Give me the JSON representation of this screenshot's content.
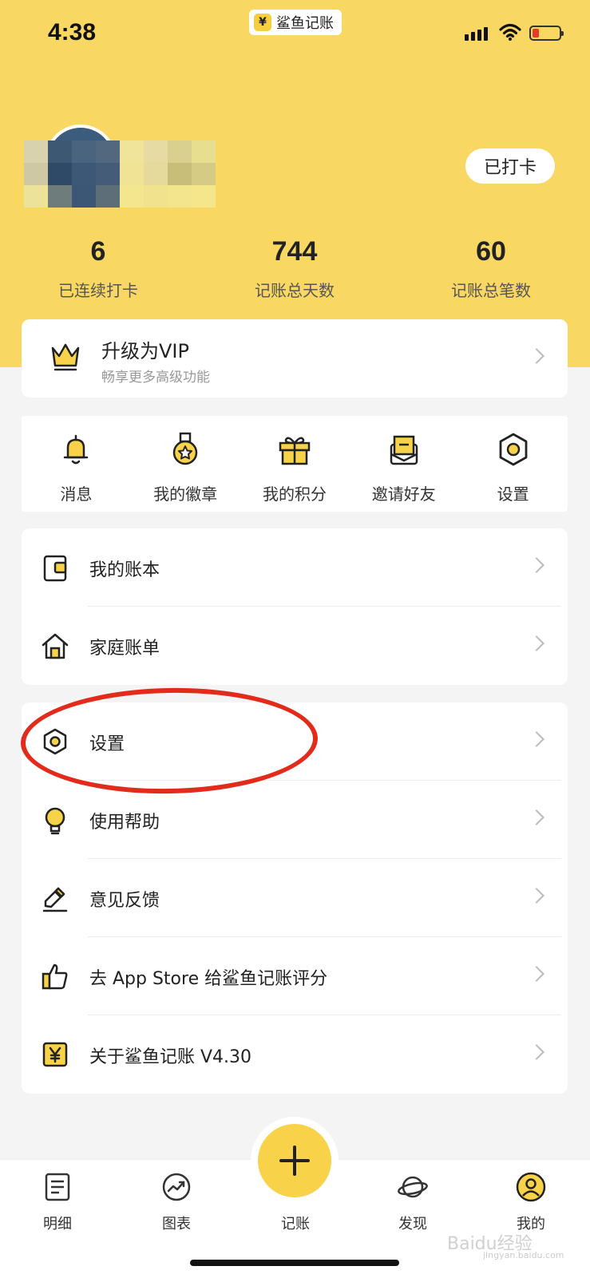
{
  "status_bar": {
    "time": "4:38",
    "app_badge": "鲨鱼记账",
    "app_badge_icon": "¥"
  },
  "profile": {
    "checkin_label": "已打卡"
  },
  "stats": [
    {
      "value": "6",
      "label": "已连续打卡"
    },
    {
      "value": "744",
      "label": "记账总天数"
    },
    {
      "value": "60",
      "label": "记账总笔数"
    }
  ],
  "vip": {
    "title": "升级为VIP",
    "subtitle": "畅享更多高级功能"
  },
  "quick_actions": [
    {
      "label": "消息",
      "icon": "bell-icon"
    },
    {
      "label": "我的徽章",
      "icon": "medal-icon"
    },
    {
      "label": "我的积分",
      "icon": "gift-icon"
    },
    {
      "label": "邀请好友",
      "icon": "envelope-icon"
    },
    {
      "label": "设置",
      "icon": "hexagon-gear-icon"
    }
  ],
  "menu_group_1": [
    {
      "label": "我的账本",
      "icon": "ledger-icon"
    },
    {
      "label": "家庭账单",
      "icon": "house-icon"
    }
  ],
  "menu_group_2": [
    {
      "label": "设置",
      "icon": "hexagon-gear-icon"
    },
    {
      "label": "使用帮助",
      "icon": "lightbulb-icon"
    },
    {
      "label": "意见反馈",
      "icon": "pencil-icon"
    },
    {
      "label": "去 App Store 给鲨鱼记账评分",
      "icon": "thumbs-up-icon"
    },
    {
      "label": "关于鲨鱼记账 V4.30",
      "icon": "yen-badge-icon"
    }
  ],
  "tabbar": [
    {
      "label": "明细",
      "icon": "document-icon"
    },
    {
      "label": "图表",
      "icon": "trend-chart-icon"
    },
    {
      "label": "记账",
      "icon": "plus-icon"
    },
    {
      "label": "发现",
      "icon": "planet-icon"
    },
    {
      "label": "我的",
      "icon": "user-circle-icon"
    }
  ],
  "watermark": {
    "text": "Baidu经验",
    "sub": "jingyan.baidu.com"
  },
  "colors": {
    "accent": "#f8d862",
    "highlight_ring": "#e32b1c",
    "icon_fill": "#f8d349"
  }
}
